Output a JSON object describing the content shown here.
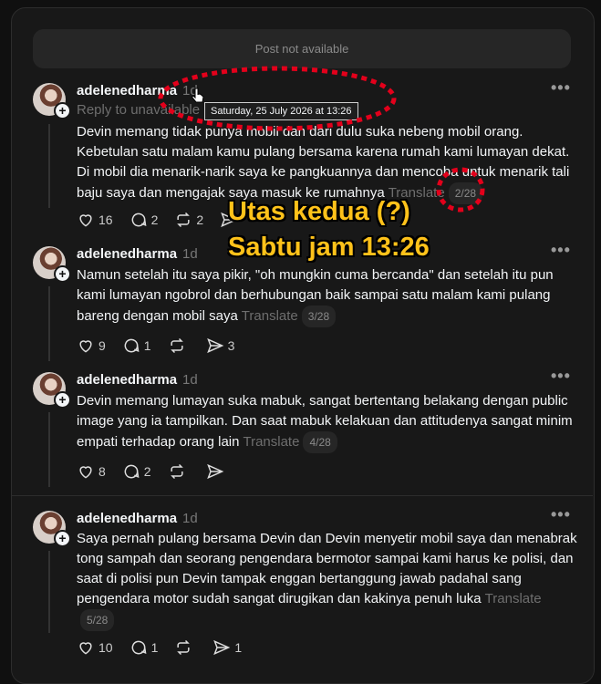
{
  "banner": "Post not available",
  "tooltip": "Saturday, 25 July 2026 at 13:26",
  "annotation": {
    "line1": "Utas kedua (?)",
    "line2": "Sabtu jam 13:26",
    "color": "#e3001b"
  },
  "posts": [
    {
      "username": "adelenedharma",
      "time": "1d",
      "reply_to": "Reply to unavailable",
      "text": "Devin memang tidak punya mobil dan dari dulu suka nebeng mobil orang. Kebetulan satu malam kamu pulang bersama karena rumah kami lumayan dekat. Di mobil dia menarik-narik saya ke pangkuannya dan mencoba untuk menarik tali baju saya dan mengajak saya masuk ke rumahnya",
      "translate": "Translate",
      "pager": "2/28",
      "likes": "16",
      "comments": "2",
      "reposts": "2",
      "shares": ""
    },
    {
      "username": "adelenedharma",
      "time": "1d",
      "text": "Namun setelah itu saya pikir, \"oh mungkin cuma bercanda\" dan setelah itu pun kami lumayan ngobrol dan berhubungan baik sampai satu malam kami pulang bareng dengan mobil saya",
      "translate": "Translate",
      "pager": "3/28",
      "likes": "9",
      "comments": "1",
      "reposts": "",
      "shares": "3"
    },
    {
      "username": "adelenedharma",
      "time": "1d",
      "text": "Devin memang lumayan suka mabuk, sangat bertentang belakang dengan public image yang ia tampilkan. Dan saat mabuk kelakuan dan attitudenya sangat minim empati terhadap orang lain",
      "translate": "Translate",
      "pager": "4/28",
      "likes": "8",
      "comments": "2",
      "reposts": "",
      "shares": ""
    },
    {
      "username": "adelenedharma",
      "time": "1d",
      "text": "Saya pernah pulang bersama Devin dan Devin menyetir mobil saya dan menabrak tong sampah dan seorang pengendara bermotor sampai kami harus ke polisi, dan saat di polisi pun Devin tampak enggan bertanggung jawab padahal sang pengendara motor sudah sangat dirugikan dan kakinya penuh luka",
      "translate": "Translate",
      "pager": "5/28",
      "likes": "10",
      "comments": "1",
      "reposts": "",
      "shares": "1"
    }
  ]
}
